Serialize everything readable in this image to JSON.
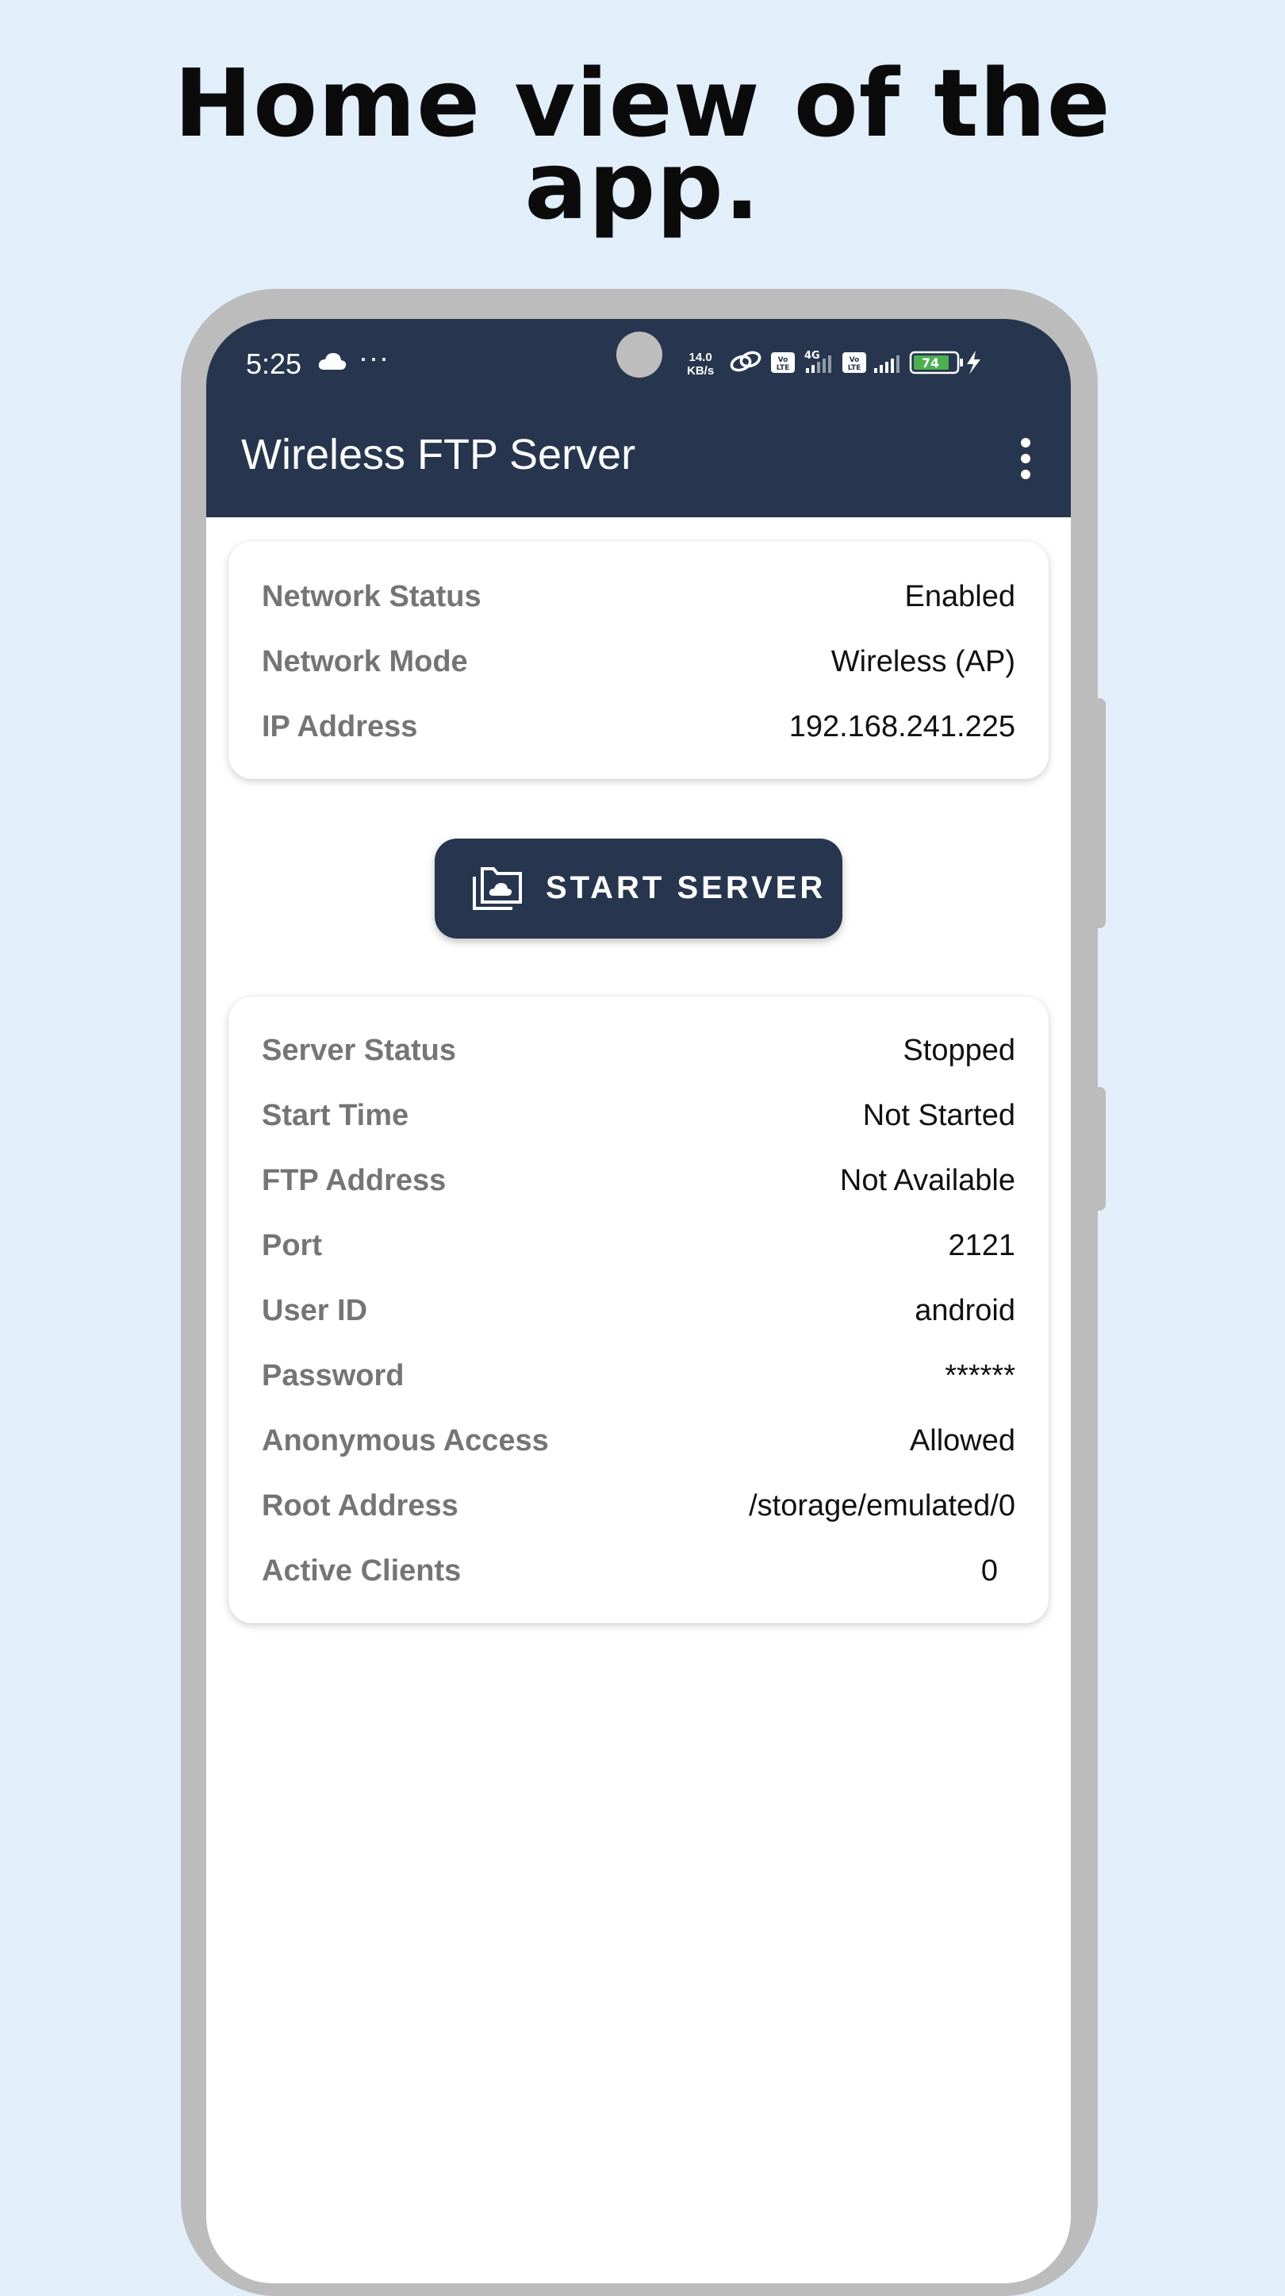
{
  "headline": [
    "Home view of the",
    "app."
  ],
  "status_bar": {
    "time": "5:25",
    "net_speed_value": "14.0",
    "net_speed_unit": "KB/s",
    "network_type": "4G",
    "volte_label": "Vo LTE",
    "battery": "74"
  },
  "app_bar": {
    "title": "Wireless FTP Server",
    "menu_icon": "more-vert-icon"
  },
  "network_card": {
    "rows": [
      {
        "label": "Network Status",
        "value": "Enabled"
      },
      {
        "label": "Network Mode",
        "value": "Wireless (AP)"
      },
      {
        "label": "IP Address",
        "value": "192.168.241.225"
      }
    ]
  },
  "start_button": {
    "label": "START SERVER",
    "icon": "folder-cloud-icon"
  },
  "server_card": {
    "rows": [
      {
        "label": "Server Status",
        "value": "Stopped"
      },
      {
        "label": "Start Time",
        "value": "Not Started"
      },
      {
        "label": "FTP Address",
        "value": "Not Available"
      },
      {
        "label": "Port",
        "value": "2121"
      },
      {
        "label": "User ID",
        "value": "android"
      },
      {
        "label": "Password",
        "value": "******"
      },
      {
        "label": "Anonymous Access",
        "value": "Allowed"
      },
      {
        "label": "Root Address",
        "value": "/storage/emulated/0"
      },
      {
        "label": "Active Clients",
        "value": "0"
      }
    ]
  },
  "colors": {
    "page_background": "#e2effb",
    "primary": "#27364e",
    "label_gray": "#757575",
    "battery_green": "#4caf50"
  }
}
